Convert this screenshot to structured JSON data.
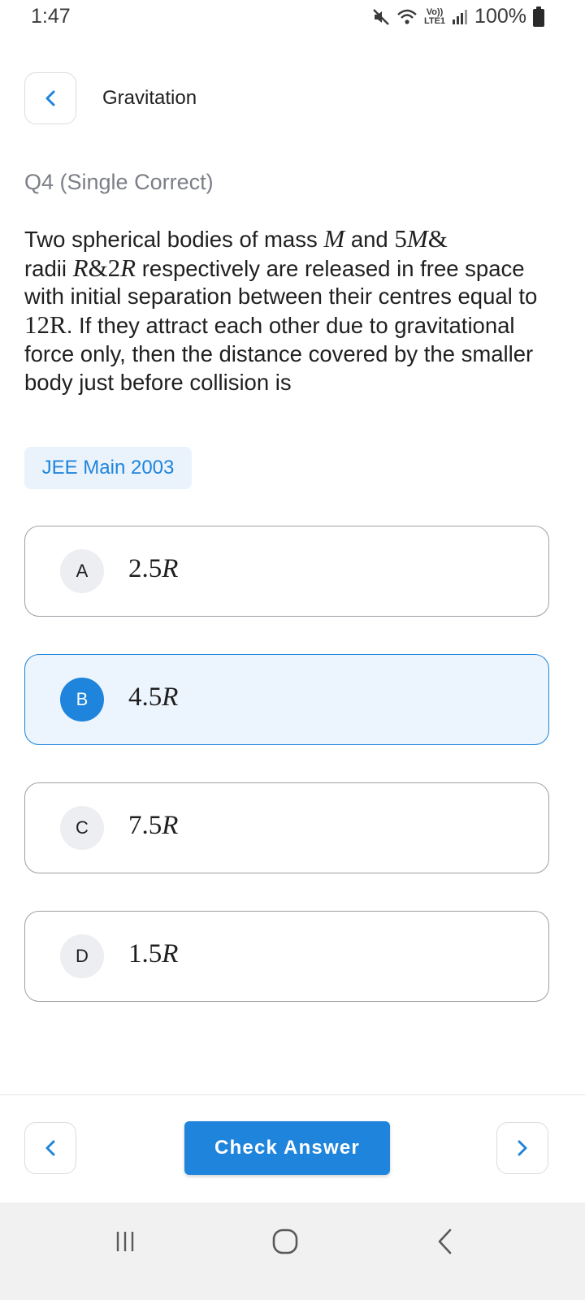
{
  "status_bar": {
    "time": "1:47",
    "lte_top": "Vo))",
    "lte_bottom": "LTE1",
    "battery": "100%",
    "icons": [
      "mute-icon",
      "wifi-icon",
      "signal-icon",
      "battery-icon"
    ]
  },
  "header": {
    "title": "Gravitation",
    "back_icon": "chevron-left-icon"
  },
  "question": {
    "label": "Q4 (Single Correct)",
    "text_parts": [
      "Two spherical bodies of mass ",
      "M",
      " and ",
      "5",
      "M",
      "&",
      "radii ",
      "R",
      "&2",
      "R",
      " respectively are released in free space with initial separation between their centres equal to ",
      "12R",
      ". If they attract each other due to gravitational force only, then the distance covered by the smaller body just before collision is"
    ],
    "tag": "JEE Main 2003"
  },
  "options": [
    {
      "letter": "A",
      "num": "2.5",
      "unit": "R",
      "selected": false
    },
    {
      "letter": "B",
      "num": "4.5",
      "unit": "R",
      "selected": true
    },
    {
      "letter": "C",
      "num": "7.5",
      "unit": "R",
      "selected": false
    },
    {
      "letter": "D",
      "num": "1.5",
      "unit": "R",
      "selected": false
    }
  ],
  "footer": {
    "prev_icon": "chevron-left-icon",
    "check_label": "Check Answer",
    "next_icon": "chevron-right-icon"
  },
  "system_nav": {
    "icons": [
      "recent-apps-icon",
      "home-icon",
      "back-icon"
    ]
  },
  "colors": {
    "accent": "#1e84dc",
    "selected_bg": "#ecf4fd",
    "tag_bg": "#eaf3fc",
    "muted_text": "#7b7f87"
  }
}
